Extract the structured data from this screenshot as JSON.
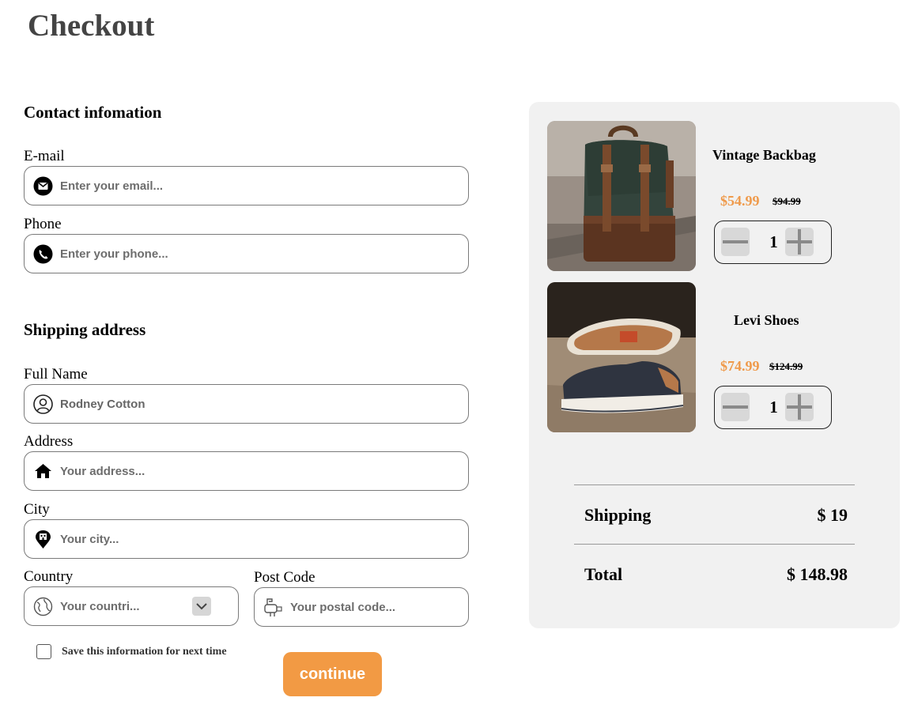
{
  "page": {
    "title": "Checkout"
  },
  "contact": {
    "title": "Contact infomation",
    "email": {
      "label": "E-mail",
      "placeholder": "Enter your email...",
      "icon": "envelope-icon"
    },
    "phone": {
      "label": "Phone",
      "placeholder": "Enter your phone...",
      "icon": "phone-icon"
    }
  },
  "shipping": {
    "title": "Shipping address",
    "full_name": {
      "label": "Full Name",
      "value": "Rodney Cotton",
      "icon": "user-icon"
    },
    "address": {
      "label": "Address",
      "placeholder": "Your address...",
      "icon": "home-icon"
    },
    "city": {
      "label": "City",
      "placeholder": "Your city...",
      "icon": "city-pin-icon"
    },
    "country": {
      "label": "Country",
      "placeholder": "Your countri...",
      "icon": "globe-icon",
      "dropdown_icon": "chevron-down-icon"
    },
    "post_code": {
      "label": "Post Code",
      "placeholder": "Your postal code...",
      "icon": "mailbox-icon"
    }
  },
  "save_info": {
    "label": "Save this information for next time",
    "checked": false
  },
  "continue_label": "continue",
  "cart": {
    "items": [
      {
        "name": "Vintage Backbag",
        "price": "$54.99",
        "old_price": "$94.99",
        "quantity": "1"
      },
      {
        "name": "Levi Shoes",
        "price": "$74.99",
        "old_price": "$124.99",
        "quantity": "1"
      }
    ],
    "shipping_label": "Shipping",
    "shipping_value": "$ 19",
    "total_label": "Total",
    "total_value": "$ 148.98"
  },
  "colors": {
    "accent": "#f29a44",
    "price": "#ef9a4b",
    "panel": "#f1f1f1",
    "title": "#444444"
  }
}
